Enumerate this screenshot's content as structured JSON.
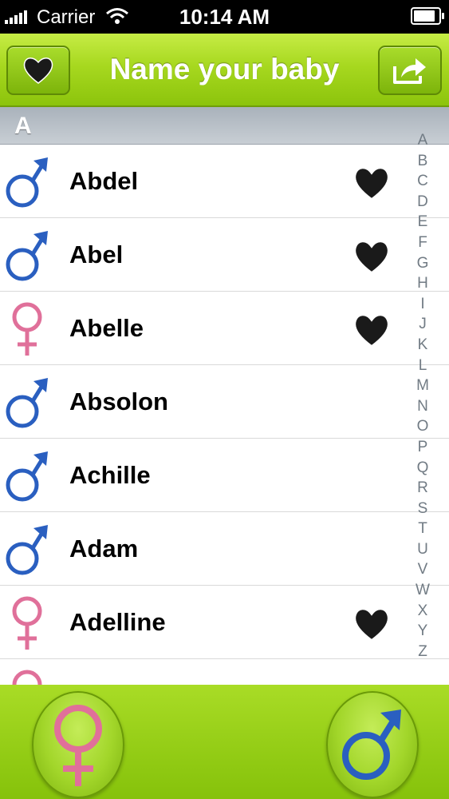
{
  "status_bar": {
    "carrier": "Carrier",
    "time": "10:14 AM",
    "battery_level": 1.0
  },
  "nav": {
    "title": "Name your baby",
    "left_button_icon": "heart-icon",
    "right_button_icon": "share-icon"
  },
  "section": {
    "header": "A"
  },
  "names": [
    {
      "name": "Abdel",
      "gender": "male",
      "favorite": true
    },
    {
      "name": "Abel",
      "gender": "male",
      "favorite": true
    },
    {
      "name": "Abelle",
      "gender": "female",
      "favorite": true
    },
    {
      "name": "Absolon",
      "gender": "male",
      "favorite": false
    },
    {
      "name": "Achille",
      "gender": "male",
      "favorite": false
    },
    {
      "name": "Adam",
      "gender": "male",
      "favorite": false
    },
    {
      "name": "Adelline",
      "gender": "female",
      "favorite": true
    },
    {
      "name": "",
      "gender": "female",
      "favorite": false
    }
  ],
  "index_letters": [
    "A",
    "B",
    "C",
    "D",
    "E",
    "F",
    "G",
    "H",
    "I",
    "J",
    "K",
    "L",
    "M",
    "N",
    "O",
    "P",
    "Q",
    "R",
    "S",
    "T",
    "U",
    "V",
    "W",
    "X",
    "Y",
    "Z"
  ],
  "bottom_bar": {
    "left_button_icon": "female-symbol-icon",
    "right_button_icon": "male-symbol-icon"
  },
  "colors": {
    "male": "#2a5fc0",
    "female": "#e0709a",
    "nav_green": "#a7d81f"
  }
}
